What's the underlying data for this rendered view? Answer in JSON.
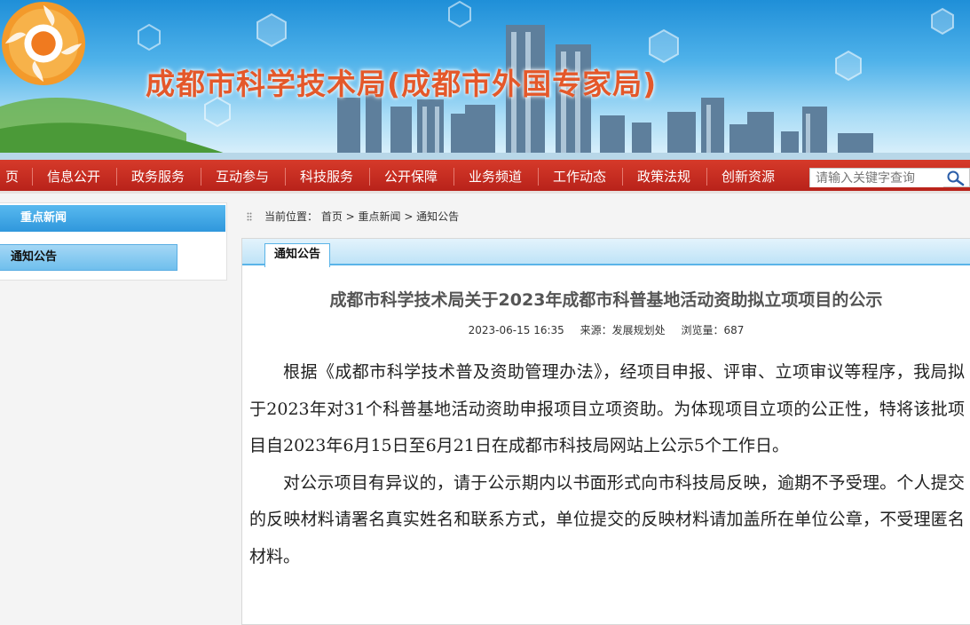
{
  "header": {
    "site_title": "成都市科学技术局(成都市外国专家局)"
  },
  "nav": {
    "items": [
      "页",
      "信息公开",
      "政务服务",
      "互动参与",
      "科技服务",
      "公开保障",
      "业务频道",
      "工作动态",
      "政策法规",
      "创新资源"
    ],
    "search_placeholder": "请输入关键字查询"
  },
  "sidebar": {
    "heading": "重点新闻",
    "items": [
      "通知公告"
    ]
  },
  "breadcrumb": {
    "text": "当前位置： 首页 > 重点新闻 > 通知公告"
  },
  "article": {
    "tab_label": "通知公告",
    "title": "成都市科学技术局关于2023年成都市科普基地活动资助拟立项项目的公示",
    "datetime": "2023-06-15 16:35",
    "source": "来源：发展规划处",
    "views": "浏览量：687",
    "paragraphs": [
      "根据《成都市科学技术普及资助管理办法》，经项目申报、评审、立项审议等程序，我局拟于2023年对31个科普基地活动资助申报项目立项资助。为体现项目立项的公正性，特将该批项目自2023年6月15日至6月21日在成都市科技局网站上公示5个工作日。",
      "对公示项目有异议的，请于公示期内以书面形式向市科技局反映，逾期不予受理。个人提交的反映材料请署名真实姓名和联系方式，单位提交的反映材料请加盖所在单位公章，不受理匿名材料。"
    ]
  },
  "colors": {
    "nav_red": "#c62b1f",
    "title_orange": "#e4582a",
    "accent_blue": "#2f97dc"
  }
}
